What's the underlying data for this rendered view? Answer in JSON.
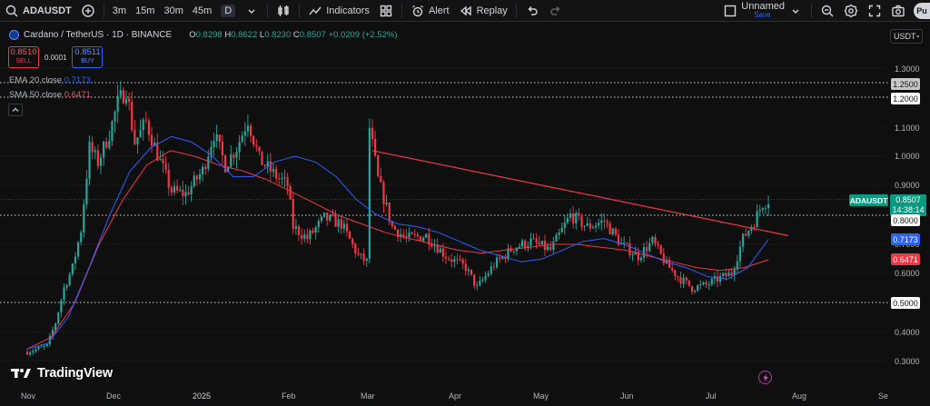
{
  "toolbar": {
    "symbol": "ADAUSDT",
    "intervals": [
      "3m",
      "15m",
      "30m",
      "45m",
      "D"
    ],
    "indicators_label": "Indicators",
    "alert_label": "Alert",
    "replay_label": "Replay",
    "layout_name": "Unnamed",
    "layout_status": "Save",
    "publish_label": "Pu"
  },
  "legend": {
    "title": "Cardano / TetherUS · 1D · BINANCE",
    "o_label": "O",
    "o_value": "0.8298",
    "h_label": "H",
    "h_value": "0.8622",
    "l_label": "L",
    "l_value": "0.8230",
    "c_label": "C",
    "c_value": "0.8507",
    "change": "+0.0209 (+2.52%)"
  },
  "trade": {
    "sell_price": "0.8510",
    "sell_label": "SELL",
    "spread": "0.0001",
    "buy_price": "0.8511",
    "buy_label": "BUY"
  },
  "indicators": {
    "ema_label": "EMA 20 close",
    "ema_value": "0.7173",
    "sma_label": "SMA 50 close",
    "sma_value": "0.6471"
  },
  "currency": "USDT",
  "price_axis": [
    "1.3000",
    "1.1000",
    "1.0000",
    "0.9000",
    "0.7000",
    "0.6000",
    "0.4000",
    "0.3000"
  ],
  "price_tags": {
    "hl_1_25": "1.2500",
    "hl_1_20": "1.2000",
    "hl_0_80": "0.8000",
    "hl_0_50": "0.5000",
    "ema": "0.7173",
    "sma": "0.6471",
    "symbol": "ADAUSDT",
    "last": "0.8507",
    "countdown": "14:38:14"
  },
  "time_axis": [
    "Nov",
    "Dec",
    "2025",
    "Feb",
    "Mar",
    "Apr",
    "May",
    "Jun",
    "Jul",
    "Aug",
    "Se"
  ],
  "brand": "TradingView",
  "colors": {
    "up": "#26a69a",
    "down": "#f23645",
    "ema": "#2962ff",
    "sma": "#f23645",
    "trendline": "#f23645"
  },
  "chart_data": {
    "type": "candlestick",
    "symbol": "ADAUSDT",
    "interval": "1D",
    "ylim": [
      0.28,
      1.38
    ],
    "horizontal_levels": [
      1.25,
      1.2,
      0.8,
      0.5
    ],
    "trendline": [
      [
        "Mar 3",
        1.02
      ],
      [
        "Jul 28",
        0.73
      ]
    ],
    "series_close": [
      {
        "date": "Nov 1",
        "close": 0.33
      },
      {
        "date": "Nov 8",
        "close": 0.35
      },
      {
        "date": "Nov 11",
        "close": 0.43
      },
      {
        "date": "Nov 14",
        "close": 0.55
      },
      {
        "date": "Nov 17",
        "close": 0.62
      },
      {
        "date": "Nov 20",
        "close": 0.75
      },
      {
        "date": "Nov 23",
        "close": 1.03
      },
      {
        "date": "Nov 26",
        "close": 0.98
      },
      {
        "date": "Nov 30",
        "close": 1.08
      },
      {
        "date": "Dec 3",
        "close": 1.18
      },
      {
        "date": "Dec 6",
        "close": 1.23
      },
      {
        "date": "Dec 9",
        "close": 1.05
      },
      {
        "date": "Dec 13",
        "close": 1.12
      },
      {
        "date": "Dec 18",
        "close": 0.98
      },
      {
        "date": "Dec 22",
        "close": 0.88
      },
      {
        "date": "Dec 27",
        "close": 0.87
      },
      {
        "date": "Jan 2",
        "close": 0.95
      },
      {
        "date": "Jan 6",
        "close": 1.08
      },
      {
        "date": "Jan 10",
        "close": 0.97
      },
      {
        "date": "Jan 14",
        "close": 1.03
      },
      {
        "date": "Jan 18",
        "close": 1.13
      },
      {
        "date": "Jan 22",
        "close": 0.99
      },
      {
        "date": "Jan 27",
        "close": 0.94
      },
      {
        "date": "Feb 1",
        "close": 0.9
      },
      {
        "date": "Feb 3",
        "close": 0.76
      },
      {
        "date": "Feb 8",
        "close": 0.72
      },
      {
        "date": "Feb 14",
        "close": 0.79
      },
      {
        "date": "Feb 20",
        "close": 0.77
      },
      {
        "date": "Feb 26",
        "close": 0.66
      },
      {
        "date": "Mar 1",
        "close": 0.64
      },
      {
        "date": "Mar 2",
        "close": 1.1
      },
      {
        "date": "Mar 5",
        "close": 0.92
      },
      {
        "date": "Mar 10",
        "close": 0.76
      },
      {
        "date": "Mar 15",
        "close": 0.72
      },
      {
        "date": "Mar 22",
        "close": 0.73
      },
      {
        "date": "Mar 29",
        "close": 0.66
      },
      {
        "date": "Apr 5",
        "close": 0.62
      },
      {
        "date": "Apr 9",
        "close": 0.55
      },
      {
        "date": "Apr 15",
        "close": 0.63
      },
      {
        "date": "Apr 22",
        "close": 0.69
      },
      {
        "date": "Apr 28",
        "close": 0.71
      },
      {
        "date": "May 5",
        "close": 0.68
      },
      {
        "date": "May 12",
        "close": 0.8
      },
      {
        "date": "May 18",
        "close": 0.76
      },
      {
        "date": "May 24",
        "close": 0.78
      },
      {
        "date": "May 30",
        "close": 0.7
      },
      {
        "date": "Jun 5",
        "close": 0.66
      },
      {
        "date": "Jun 10",
        "close": 0.71
      },
      {
        "date": "Jun 15",
        "close": 0.63
      },
      {
        "date": "Jun 20",
        "close": 0.58
      },
      {
        "date": "Jun 24",
        "close": 0.55
      },
      {
        "date": "Jun 29",
        "close": 0.56
      },
      {
        "date": "Jul 3",
        "close": 0.58
      },
      {
        "date": "Jul 8",
        "close": 0.6
      },
      {
        "date": "Jul 12",
        "close": 0.72
      },
      {
        "date": "Jul 16",
        "close": 0.78
      },
      {
        "date": "Jul 19",
        "close": 0.84
      },
      {
        "date": "Jul 21",
        "close": 0.8507
      }
    ],
    "ema20": [
      0.34,
      0.36,
      0.45,
      0.62,
      0.8,
      0.95,
      1.03,
      1.07,
      1.05,
      1.0,
      0.93,
      0.93,
      0.98,
      1.0,
      0.98,
      0.93,
      0.85,
      0.8,
      0.77,
      0.76,
      0.74,
      0.71,
      0.68,
      0.66,
      0.64,
      0.65,
      0.68,
      0.71,
      0.72,
      0.7,
      0.67,
      0.64,
      0.62,
      0.59,
      0.58,
      0.62,
      0.7173
    ],
    "sma50": [
      0.34,
      0.38,
      0.5,
      0.7,
      0.85,
      0.97,
      1.02,
      1.0,
      0.97,
      0.95,
      0.92,
      0.88,
      0.84,
      0.8,
      0.77,
      0.74,
      0.72,
      0.7,
      0.68,
      0.67,
      0.68,
      0.69,
      0.7,
      0.7,
      0.69,
      0.68,
      0.66,
      0.64,
      0.62,
      0.61,
      0.62,
      0.6471
    ]
  }
}
